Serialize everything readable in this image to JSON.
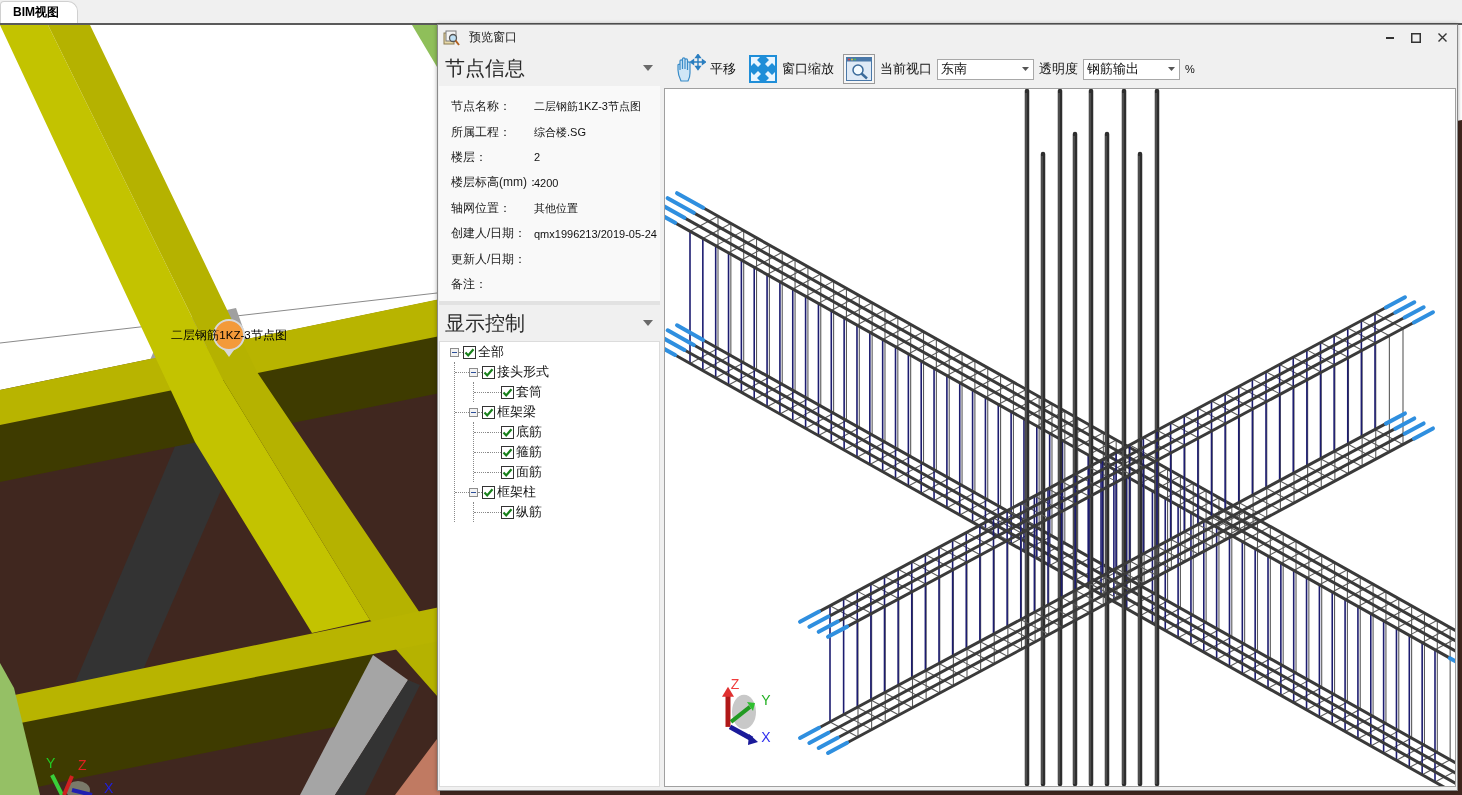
{
  "tabs": [
    {
      "label": "BIM视图",
      "selected": true
    }
  ],
  "bim_view": {
    "marker_label": "二层钢筋1KZ-3节点图",
    "axis_labels": [
      {
        "text": "Y",
        "color": "#22cc22"
      },
      {
        "text": "Z",
        "color": "#e02020"
      },
      {
        "text": "X",
        "color": "#2020e0"
      }
    ]
  },
  "preview_window": {
    "title": "预览窗口",
    "node_info": {
      "heading": "节点信息",
      "fields": [
        {
          "label": "节点名称：",
          "value": "二层钢筋1KZ-3节点图"
        },
        {
          "label": "所属工程：",
          "value": "综合楼.SG"
        },
        {
          "label": "楼层：",
          "value": "2"
        },
        {
          "label": "楼层标高(mm)：",
          "value": "4200"
        },
        {
          "label": "轴网位置：",
          "value": "其他位置"
        },
        {
          "label": "创建人/日期：",
          "value": "qmx1996213/2019-05-24"
        },
        {
          "label": "更新人/日期："
        },
        {
          "label": "备注："
        }
      ]
    },
    "display_control": {
      "heading": "显示控制",
      "tree": [
        {
          "label": "全部",
          "checked": true,
          "expanded": true,
          "children": [
            {
              "label": "接头形式",
              "checked": true,
              "expanded": true,
              "children": [
                {
                  "label": "套筒",
                  "checked": true
                }
              ]
            },
            {
              "label": "框架梁",
              "checked": true,
              "expanded": true,
              "children": [
                {
                  "label": "底筋",
                  "checked": true
                },
                {
                  "label": "箍筋",
                  "checked": true
                },
                {
                  "label": "面筋",
                  "checked": true
                }
              ]
            },
            {
              "label": "框架柱",
              "checked": true,
              "expanded": true,
              "children": [
                {
                  "label": "纵筋",
                  "checked": true
                }
              ]
            }
          ]
        }
      ]
    },
    "toolbar": [
      {
        "kind": "pan",
        "label": "平移"
      },
      {
        "kind": "zoom_window",
        "label": "窗口缩放"
      },
      {
        "kind": "view_picker",
        "label": "当前视口",
        "value": "东南"
      },
      {
        "kind": "transparency",
        "label": "透明度",
        "value": "钢筋输出",
        "unit": "%"
      }
    ],
    "viewport": {
      "axis_labels": [
        {
          "text": "Z",
          "color": "#f03c3c"
        },
        {
          "text": "Y",
          "color": "#22b022"
        },
        {
          "text": "X",
          "color": "#3030f0"
        }
      ]
    }
  }
}
